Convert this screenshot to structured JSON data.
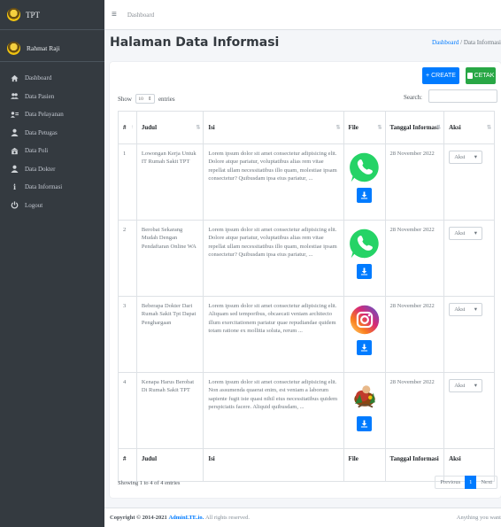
{
  "brand": "TPT",
  "user": "Rahmat Raji",
  "nav": [
    {
      "label": "Dashboard",
      "icon": "home-icon"
    },
    {
      "label": "Data Pasien",
      "icon": "users-icon"
    },
    {
      "label": "Data Pelayanan",
      "icon": "user-card-icon"
    },
    {
      "label": "Data Petugas",
      "icon": "user-icon"
    },
    {
      "label": "Data Poli",
      "icon": "clinic-icon"
    },
    {
      "label": "Data Dokter",
      "icon": "doctor-icon"
    },
    {
      "label": "Data Informasi",
      "icon": "info-icon"
    },
    {
      "label": "Logout",
      "icon": "power-icon"
    }
  ],
  "topbar": {
    "link": "Dashboard"
  },
  "page": {
    "title": "Halaman Data Informasi"
  },
  "breadcrumb": {
    "home": "Dashboard",
    "sep": "/",
    "current": "Data Informasi"
  },
  "buttons": {
    "create": "+ CREATE",
    "cetak": "CETAK"
  },
  "table_controls": {
    "show": "Show",
    "entries_value": "10",
    "entries": "entries",
    "search": "Search:"
  },
  "columns": [
    "#",
    "Judul",
    "Isi",
    "File",
    "Tanggal Informasi",
    "Aksi"
  ],
  "rows": [
    {
      "no": "1",
      "judul": "Lowongan Kerja Untuk IT Rumah Sakit TPT",
      "isi": "Lorem ipsum dolor sit amet consectetur adipisicing elit. Dolore atque pariatur, voluptatibus alias rem vitae repellat ullam necessitatibus illo quam, molestiae ipsam consectetur? Quibusdam ipsa eius pariatur, ...",
      "file": "whatsapp-logo",
      "tanggal": "28 November 2022",
      "aksi": "Aksi"
    },
    {
      "no": "2",
      "judul": "Berobat Sekarang Mudah Dengan Pendaftaran Online WA",
      "isi": "Lorem ipsum dolor sit amet consectetur adipisicing elit. Dolore atque pariatur, voluptatibus alias rem vitae repellat ullam necessitatibus illo quam, molestiae ipsam consectetur? Quibusdam ipsa eius pariatur, ...",
      "file": "whatsapp-logo",
      "tanggal": "28 November 2022",
      "aksi": "Aksi"
    },
    {
      "no": "3",
      "judul": "Beberapa Dokter Dari Rumah Sakit Tpt Dapat Penghargaan",
      "isi": "Lorem ipsum dolor sit amet consectetur adipisicing elit. Aliquam sed temporibus, obcaecati veniam architecto illum exercitationem pariatur quae repudiandae quidem totam ratione ex mollitia soluta, rerum ...",
      "file": "instagram-logo",
      "tanggal": "28 November 2022",
      "aksi": "Aksi"
    },
    {
      "no": "4",
      "judul": "Kenapa Harus Berobat Di Rumah Sakit TPT",
      "isi": "Lorem ipsum dolor sit amet consectetur adipisicing elit. Non assumenda quaerat enim, est veniam a laborum sapiente fugit iste quasi nihil eius necessitatibus quidem perspiciatis facere. Aliquid quibusdam, ...",
      "file": "illustration-image",
      "tanggal": "28 November 2022",
      "aksi": "Aksi"
    }
  ],
  "info": "Showing 1 to 4 of 4 entries",
  "pager": {
    "prev": "Previous",
    "page": "1",
    "next": "Next"
  },
  "footer": {
    "copyright": "Copyright © 2014-2021",
    "brand": "AdminLTE.io.",
    "rights": "All rights reserved.",
    "right": "Anything you want"
  }
}
